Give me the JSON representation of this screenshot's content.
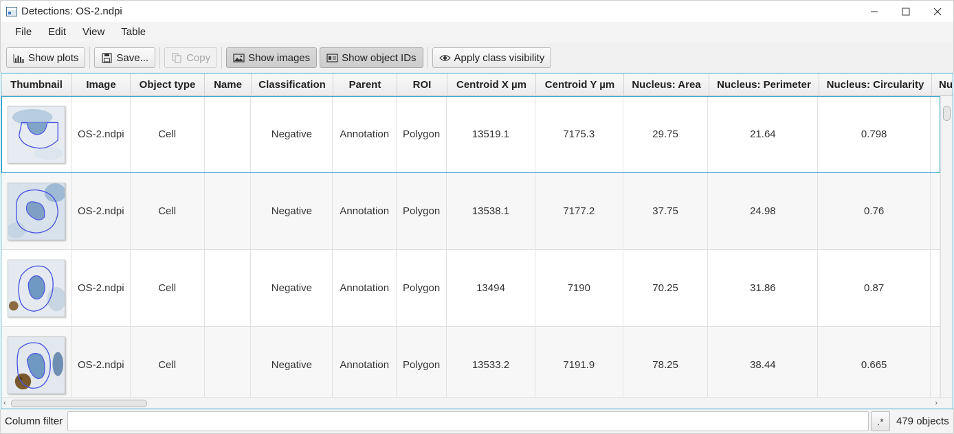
{
  "window": {
    "title": "Detections: OS-2.ndpi"
  },
  "menu": [
    "File",
    "Edit",
    "View",
    "Table"
  ],
  "toolbar": {
    "show_plots": "Show plots",
    "save": "Save...",
    "copy": "Copy",
    "show_images": "Show images",
    "show_object_ids": "Show object IDs",
    "apply_class_visibility": "Apply class visibility"
  },
  "table": {
    "columns": [
      "Thumbnail",
      "Image",
      "Object type",
      "Name",
      "Classification",
      "Parent",
      "ROI",
      "Centroid X µm",
      "Centroid Y µm",
      "Nucleus: Area",
      "Nucleus: Perimeter",
      "Nucleus: Circularity",
      "Nu"
    ],
    "rows": [
      [
        "",
        "OS-2.ndpi",
        "Cell",
        "",
        "Negative",
        "Annotation",
        "Polygon",
        "13519.1",
        "7175.3",
        "29.75",
        "21.64",
        "0.798",
        ""
      ],
      [
        "",
        "OS-2.ndpi",
        "Cell",
        "",
        "Negative",
        "Annotation",
        "Polygon",
        "13538.1",
        "7177.2",
        "37.75",
        "24.98",
        "0.76",
        ""
      ],
      [
        "",
        "OS-2.ndpi",
        "Cell",
        "",
        "Negative",
        "Annotation",
        "Polygon",
        "13494",
        "7190",
        "70.25",
        "31.86",
        "0.87",
        ""
      ],
      [
        "",
        "OS-2.ndpi",
        "Cell",
        "",
        "Negative",
        "Annotation",
        "Polygon",
        "13533.2",
        "7191.9",
        "78.25",
        "38.44",
        "0.665",
        ""
      ]
    ]
  },
  "filter": {
    "label": "Column filter",
    "value": "",
    "regex_label": ".*",
    "count": "479 objects"
  },
  "colors": {
    "selection_border": "#3fa7d0",
    "outline": "#4b55e6",
    "stain": "#8fb0d0"
  }
}
